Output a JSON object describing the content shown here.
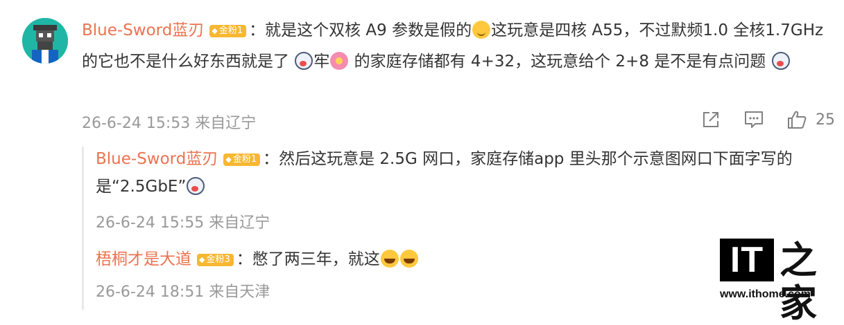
{
  "comment": {
    "username": "Blue-Sword蓝刃",
    "badge": "金粉1",
    "text_part1": "就是这个双核 A9 参数是假的",
    "text_part2": "这玩意是四核 A55，不过默频1.0 全核1.7GHz 的它也不是什么好东西就是了",
    "text_part3": "牢",
    "text_part4": " 的家庭存储都有 4+32，这玩意给个 2+8 是不是有点问题",
    "time": "26-6-24 15:53 来自辽宁",
    "like_count": "25"
  },
  "replies": [
    {
      "username": "Blue-Sword蓝刃",
      "badge": "金粉1",
      "text": "然后这玩意是 2.5G 网口，家庭存储app 里头那个示意图网口下面字写的是“2.5GbE”",
      "time": "26-6-24 15:55 来自辽宁"
    },
    {
      "username": "梧桐才是大道",
      "badge": "金粉3",
      "text": "憋了两三年，就这",
      "time": "26-6-24 18:51 来自天津"
    }
  ],
  "icons": {
    "share": "share-icon",
    "comment": "comment-icon",
    "like": "like-icon"
  },
  "watermark": {
    "logo_text": "IT",
    "logo_cn": "之家",
    "url": "www.ithome.com"
  },
  "colors": {
    "username": "#eb7350",
    "badge": "#f7b731",
    "meta": "#999999"
  }
}
